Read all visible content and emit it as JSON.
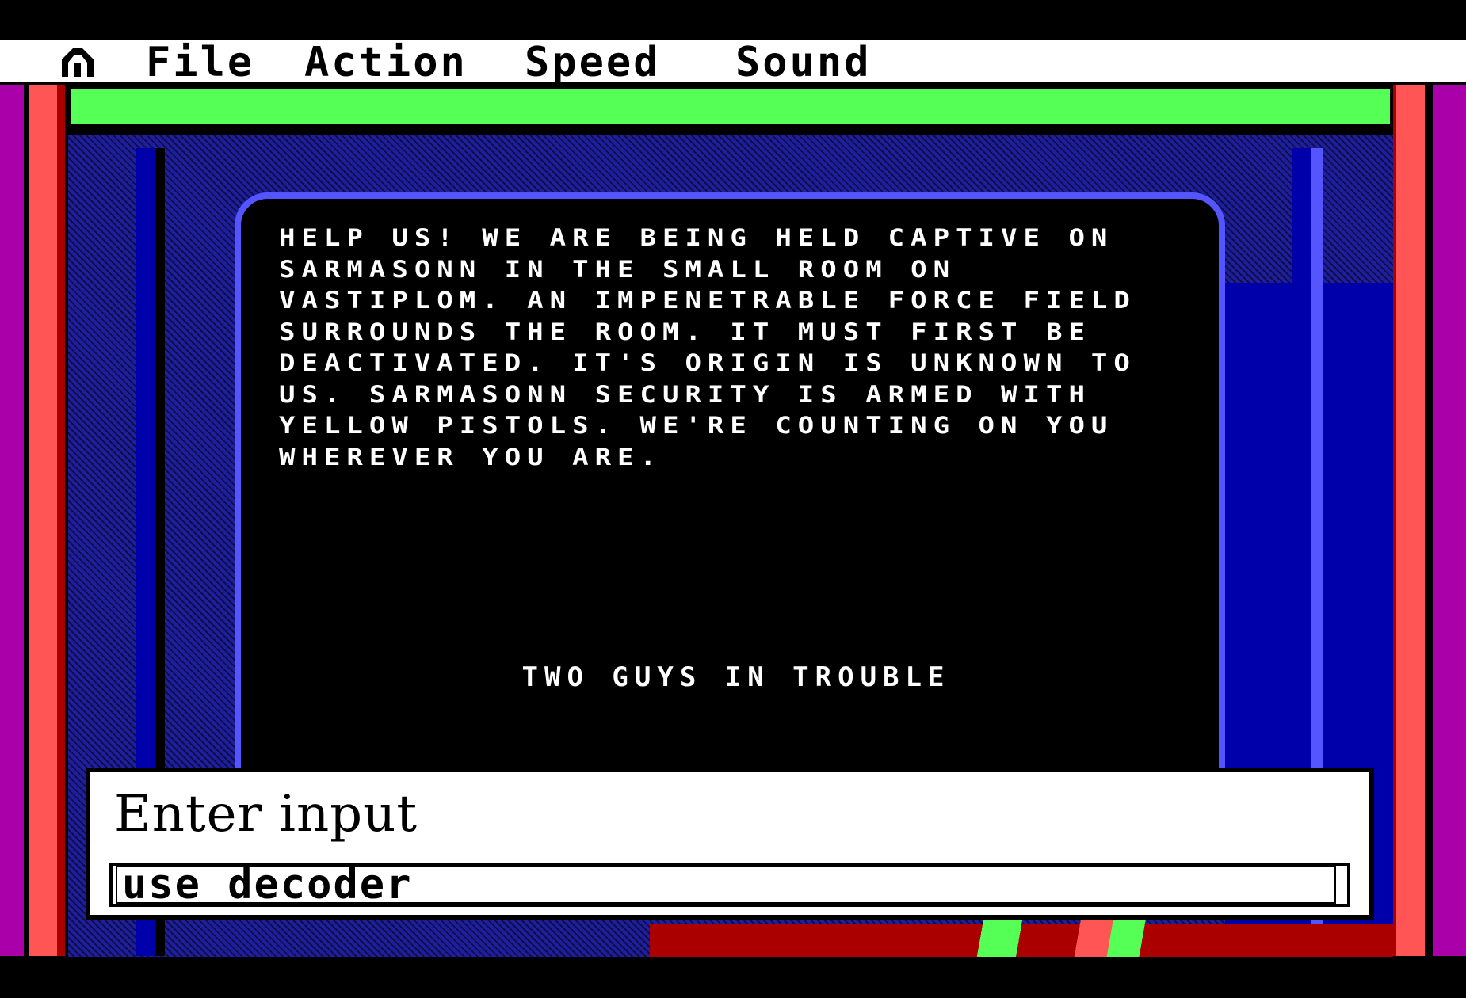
{
  "menu": {
    "icon": "sierra-icon",
    "items": [
      "File",
      "Action",
      "Speed",
      "Sound"
    ]
  },
  "message": {
    "body": "Help us! We are being held captive on Sarmasonn in the small room on Vastiplom. An impenetrable force field surrounds the room. It must first be deactivated. It's origin is unknown to us. Sarmasonn security is armed with yellow pistols. We're counting on you wherever you are.",
    "signature": "Two guys in trouble"
  },
  "dialog": {
    "title": "Enter input",
    "input_value": "use decoder"
  },
  "colors": {
    "green_panel": "#55ff55",
    "wall_blue": "#0000aa",
    "light_blue": "#5555ff",
    "red": "#ff5555",
    "magenta": "#aa00aa"
  }
}
